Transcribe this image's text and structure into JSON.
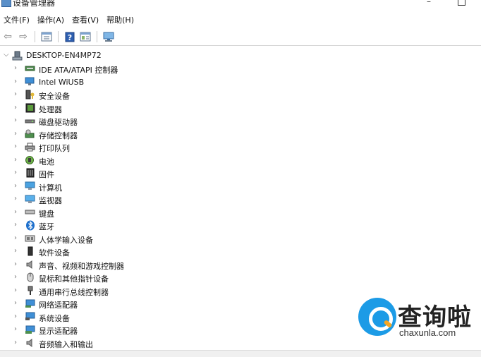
{
  "window": {
    "title": "设备管理器"
  },
  "menu": [
    {
      "label": "文件(F)"
    },
    {
      "label": "操作(A)"
    },
    {
      "label": "查看(V)"
    },
    {
      "label": "帮助(H)"
    }
  ],
  "toolbar": [
    {
      "icon": "back-arrow-icon"
    },
    {
      "icon": "forward-arrow-icon"
    },
    {
      "icon": "properties-icon"
    },
    {
      "icon": "help-icon"
    },
    {
      "icon": "view-icon"
    },
    {
      "icon": "monitor-scan-icon"
    }
  ],
  "tree": {
    "root": {
      "label": "DESKTOP-EN4MP72",
      "icon": "computer-icon"
    },
    "items": [
      {
        "label": "IDE ATA/ATAPI 控制器",
        "icon": "ide-controller-icon"
      },
      {
        "label": "Intel WiUSB",
        "icon": "network-monitor-icon"
      },
      {
        "label": "安全设备",
        "icon": "security-key-icon"
      },
      {
        "label": "处理器",
        "icon": "processor-icon"
      },
      {
        "label": "磁盘驱动器",
        "icon": "disk-drive-icon"
      },
      {
        "label": "存储控制器",
        "icon": "storage-controller-icon"
      },
      {
        "label": "打印队列",
        "icon": "printer-icon"
      },
      {
        "label": "电池",
        "icon": "battery-icon"
      },
      {
        "label": "固件",
        "icon": "firmware-icon"
      },
      {
        "label": "计算机",
        "icon": "computer-monitor-icon"
      },
      {
        "label": "监视器",
        "icon": "monitor-icon"
      },
      {
        "label": "键盘",
        "icon": "keyboard-icon"
      },
      {
        "label": "蓝牙",
        "icon": "bluetooth-icon"
      },
      {
        "label": "人体学输入设备",
        "icon": "hid-icon"
      },
      {
        "label": "软件设备",
        "icon": "software-device-icon"
      },
      {
        "label": "声音、视频和游戏控制器",
        "icon": "speaker-icon"
      },
      {
        "label": "鼠标和其他指针设备",
        "icon": "mouse-icon"
      },
      {
        "label": "通用串行总线控制器",
        "icon": "usb-icon"
      },
      {
        "label": "网络适配器",
        "icon": "network-adapter-icon"
      },
      {
        "label": "系统设备",
        "icon": "system-device-icon"
      },
      {
        "label": "显示适配器",
        "icon": "display-adapter-icon"
      },
      {
        "label": "音频输入和输出",
        "icon": "audio-io-icon"
      }
    ]
  },
  "watermark": {
    "cn": "查询啦",
    "en": "chaxunla.com"
  }
}
